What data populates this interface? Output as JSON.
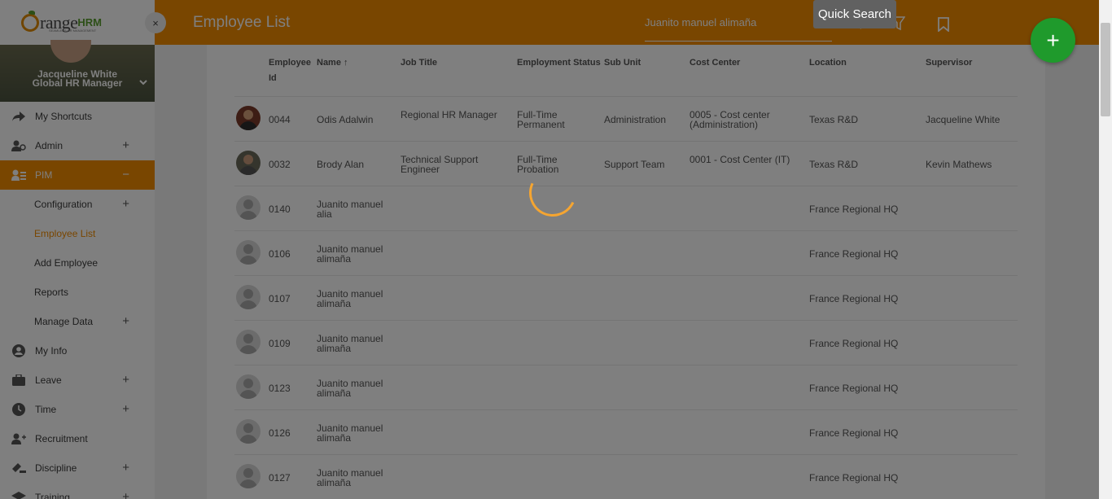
{
  "app": {
    "logo_text": "range",
    "logo_hrm": "HRM",
    "logo_tagline": "SEAMLESS HR MANAGEMENT"
  },
  "profile": {
    "name": "Jacqueline White",
    "role": "Global HR Manager"
  },
  "sidebar": {
    "items": [
      {
        "label": "My Shortcuts",
        "icon": "share-icon",
        "expandable": false
      },
      {
        "label": "Admin",
        "icon": "admin-icon",
        "expandable": true
      },
      {
        "label": "PIM",
        "icon": "pim-icon",
        "expandable": true,
        "active": true
      },
      {
        "label": "My Info",
        "icon": "user-circle-icon",
        "expandable": false
      },
      {
        "label": "Leave",
        "icon": "briefcase-icon",
        "expandable": true
      },
      {
        "label": "Time",
        "icon": "clock-icon",
        "expandable": true
      },
      {
        "label": "Recruitment",
        "icon": "recruit-icon",
        "expandable": false
      },
      {
        "label": "Discipline",
        "icon": "discipline-icon",
        "expandable": true
      },
      {
        "label": "Training",
        "icon": "training-icon",
        "expandable": true
      }
    ],
    "pim_subitems": [
      {
        "label": "Configuration",
        "expandable": true
      },
      {
        "label": "Employee List",
        "current": true
      },
      {
        "label": "Add Employee"
      },
      {
        "label": "Reports"
      },
      {
        "label": "Manage Data",
        "expandable": true
      }
    ],
    "expand_symbol": "+",
    "collapse_symbol": "−"
  },
  "header": {
    "title": "Employee List",
    "search_value": "Juanito manuel alimaña",
    "tooltip": "Quick Search",
    "add_symbol": "+",
    "close_symbol": "×"
  },
  "table": {
    "columns": [
      "Employee Id",
      "Name",
      "Job Title",
      "Employment Status",
      "Sub Unit",
      "Cost Center",
      "Location",
      "Supervisor"
    ],
    "sort_indicator": "↑",
    "rows": [
      {
        "id": "0044",
        "name": "Odis Adalwin",
        "job_title": "Regional HR Manager",
        "status": "Full-Time Permanent",
        "sub_unit": "Administration",
        "cost_center": "0005 - Cost center (Administration)",
        "location": "Texas R&D",
        "supervisor": "Jacqueline White",
        "photo": "photo1"
      },
      {
        "id": "0032",
        "name": "Brody Alan",
        "job_title": "Technical Support Engineer",
        "status": "Full-Time Probation",
        "sub_unit": "Support Team",
        "cost_center": "0001 - Cost Center (IT)",
        "location": "Texas R&D",
        "supervisor": "Kevin Mathews",
        "photo": "photo2"
      },
      {
        "id": "0140",
        "name": "Juanito manuel alia",
        "job_title": "",
        "status": "",
        "sub_unit": "",
        "cost_center": "",
        "location": "France Regional HQ",
        "supervisor": "",
        "photo": "default"
      },
      {
        "id": "0106",
        "name": "Juanito manuel alimaña",
        "job_title": "",
        "status": "",
        "sub_unit": "",
        "cost_center": "",
        "location": "France Regional HQ",
        "supervisor": "",
        "photo": "default"
      },
      {
        "id": "0107",
        "name": "Juanito manuel alimaña",
        "job_title": "",
        "status": "",
        "sub_unit": "",
        "cost_center": "",
        "location": "France Regional HQ",
        "supervisor": "",
        "photo": "default"
      },
      {
        "id": "0109",
        "name": "Juanito manuel alimaña",
        "job_title": "",
        "status": "",
        "sub_unit": "",
        "cost_center": "",
        "location": "France Regional HQ",
        "supervisor": "",
        "photo": "default"
      },
      {
        "id": "0123",
        "name": "Juanito manuel alimaña",
        "job_title": "",
        "status": "",
        "sub_unit": "",
        "cost_center": "",
        "location": "France Regional HQ",
        "supervisor": "",
        "photo": "default"
      },
      {
        "id": "0126",
        "name": "Juanito manuel alimaña",
        "job_title": "",
        "status": "",
        "sub_unit": "",
        "cost_center": "",
        "location": "France Regional HQ",
        "supervisor": "",
        "photo": "default"
      },
      {
        "id": "0127",
        "name": "Juanito manuel alimaña",
        "job_title": "",
        "status": "",
        "sub_unit": "",
        "cost_center": "",
        "location": "France Regional HQ",
        "supervisor": "",
        "photo": "default"
      }
    ]
  },
  "colors": {
    "brand_orange": "#f28c00",
    "fab_green": "#1f9a2c",
    "spinner": "#f5a531"
  }
}
